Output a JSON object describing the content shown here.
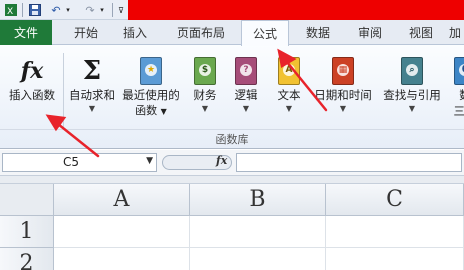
{
  "qat": {
    "save_icon": "save-icon",
    "undo_icon": "undo-icon",
    "redo_icon": "redo-icon",
    "customize_icon": "customize-qat-icon",
    "accent_color": "#ee0000"
  },
  "tabs": {
    "file": "文件",
    "items": [
      "开始",
      "插入",
      "页面布局",
      "公式",
      "数据",
      "审阅",
      "视图",
      "加"
    ],
    "active": "公式"
  },
  "ribbon": {
    "insert_function": "插入函数",
    "autosum": "自动求和",
    "recent_line1": "最近使用的",
    "recent_line2": "函数",
    "financial": "财务",
    "logical": "逻辑",
    "text": "文本",
    "datetime": "日期和时间",
    "lookup": "查找与引用",
    "math_line1": "数",
    "math_line2": "三角",
    "group_label": "函数库"
  },
  "formula_bar": {
    "name_box": "C5",
    "fx_label": "fx",
    "formula": ""
  },
  "grid": {
    "columns": [
      "A",
      "B",
      "C"
    ],
    "rows": [
      "1",
      "2"
    ]
  },
  "colors": {
    "file_tab": "#1f7a39",
    "annotation_arrow": "#e8232b"
  }
}
